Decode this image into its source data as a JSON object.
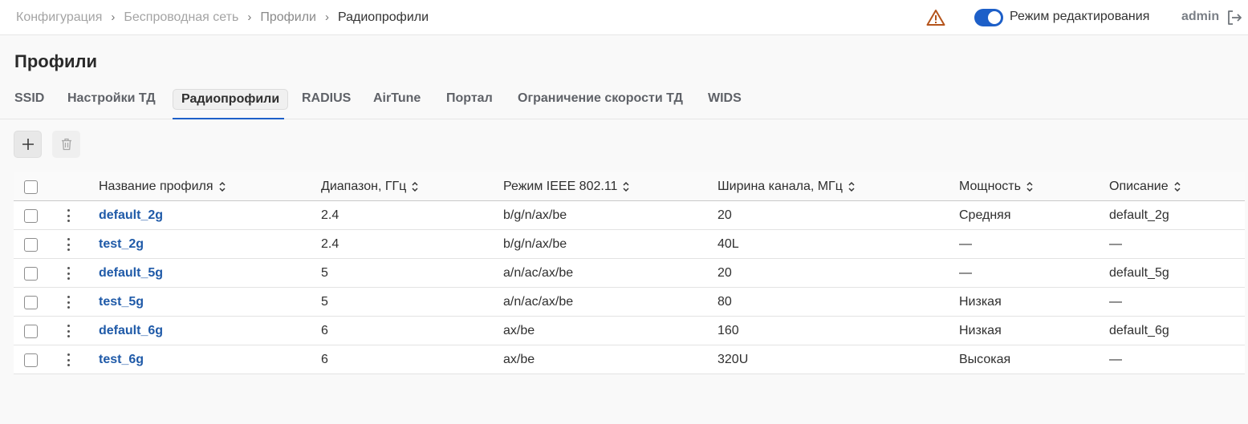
{
  "breadcrumb": {
    "items": [
      "Конфигурация",
      "Беспроводная сеть",
      "Профили",
      "Радиопрофили"
    ],
    "separator": "›"
  },
  "header": {
    "edit_mode_label": "Режим редактирования",
    "edit_mode_on": true,
    "user": "admin"
  },
  "page": {
    "title": "Профили"
  },
  "tabs": [
    {
      "label": "SSID",
      "active": false
    },
    {
      "label": "Настройки ТД",
      "active": false
    },
    {
      "label": "Радиопрофили",
      "active": true
    },
    {
      "label": "RADIUS",
      "active": false
    },
    {
      "label": "AirTune",
      "active": false
    },
    {
      "label": "Портал",
      "active": false
    },
    {
      "label": "Ограничение скорости ТД",
      "active": false
    },
    {
      "label": "WIDS",
      "active": false
    }
  ],
  "table": {
    "columns": [
      "Название профиля",
      "Диапазон, ГГц",
      "Режим IEEE 802.11",
      "Ширина канала, МГц",
      "Мощность",
      "Описание"
    ],
    "rows": [
      {
        "name": "default_2g",
        "band": "2.4",
        "mode": "b/g/n/ax/be",
        "width": "20",
        "power": "Средняя",
        "desc": "default_2g"
      },
      {
        "name": "test_2g",
        "band": "2.4",
        "mode": "b/g/n/ax/be",
        "width": "40L",
        "power": "—",
        "desc": "—"
      },
      {
        "name": "default_5g",
        "band": "5",
        "mode": "a/n/ac/ax/be",
        "width": "20",
        "power": "—",
        "desc": "default_5g"
      },
      {
        "name": "test_5g",
        "band": "5",
        "mode": "a/n/ac/ax/be",
        "width": "80",
        "power": "Низкая",
        "desc": "—"
      },
      {
        "name": "default_6g",
        "band": "6",
        "mode": "ax/be",
        "width": "160",
        "power": "Низкая",
        "desc": "default_6g"
      },
      {
        "name": "test_6g",
        "band": "6",
        "mode": "ax/be",
        "width": "320U",
        "power": "Высокая",
        "desc": "—"
      }
    ]
  },
  "colors": {
    "accent": "#1d5fc8",
    "link": "#1f5aa8",
    "warning": "#b5541b"
  }
}
